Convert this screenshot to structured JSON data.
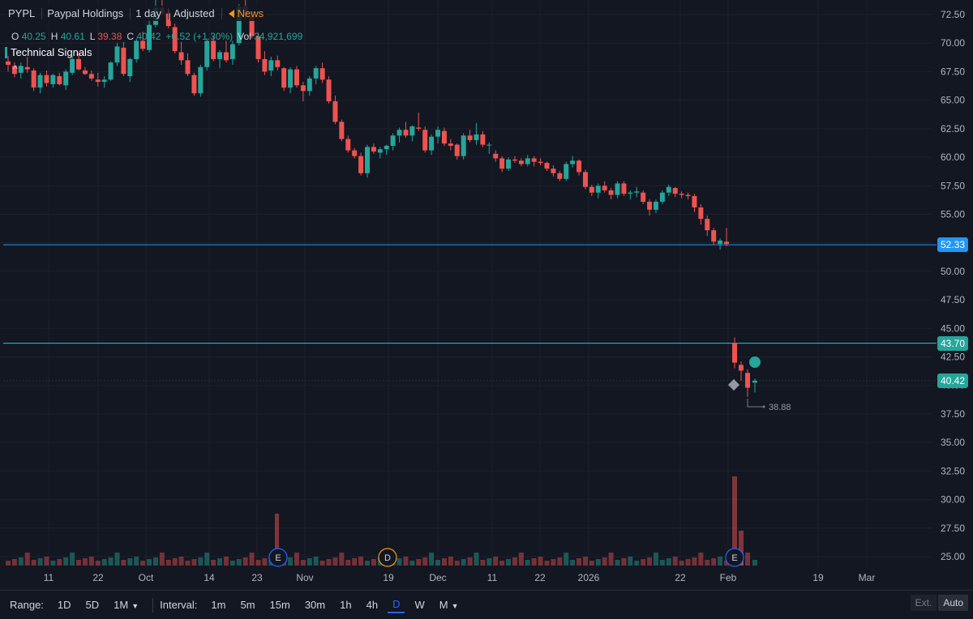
{
  "header": {
    "symbol": "PYPL",
    "name": "Paypal Holdings",
    "interval": "1 day",
    "adjusted": "Adjusted",
    "news": "News"
  },
  "ohlc": {
    "o_label": "O",
    "o": "40.25",
    "h_label": "H",
    "h": "40.61",
    "l_label": "L",
    "l": "39.38",
    "c_label": "C",
    "c": "40.42",
    "change": "+0.52 (+1.30%)",
    "vol_label": "Vol",
    "vol": "34,921,699"
  },
  "signals_label": "Technical Signals",
  "collapse_glyph": "^",
  "price_axis": [
    "72.50",
    "70.00",
    "67.50",
    "65.00",
    "62.50",
    "60.00",
    "57.50",
    "55.00",
    "52.50",
    "50.00",
    "47.50",
    "45.00",
    "42.50",
    "40.00",
    "37.50",
    "35.00",
    "32.50",
    "30.00",
    "27.50",
    "25.00"
  ],
  "price_tags": {
    "upper": "52.33",
    "mid": "43.70",
    "last": "40.42"
  },
  "low_marker": "38.88",
  "time_axis": [
    "11",
    "22",
    "Oct",
    "14",
    "23",
    "Nov",
    "19",
    "Dec",
    "11",
    "22",
    "2026",
    "22",
    "Feb",
    "19",
    "Mar"
  ],
  "events": [
    "E",
    "D",
    "E"
  ],
  "bottom": {
    "range_label": "Range:",
    "ranges": [
      "1D",
      "5D",
      "1M"
    ],
    "interval_label": "Interval:",
    "intervals": [
      "1m",
      "5m",
      "15m",
      "30m",
      "1h",
      "4h",
      "D",
      "W",
      "M"
    ],
    "active_interval": "D",
    "ext": "Ext.",
    "auto": "Auto"
  },
  "colors": {
    "up": "#26a69a",
    "down": "#ef5350",
    "bg": "#131722",
    "grid": "#1e222d",
    "line_blue": "#2196f3",
    "line_teal": "#26c6da",
    "tag_blue": "#2196f3",
    "tag_green": "#26a69a"
  },
  "chart_data": {
    "type": "candlestick",
    "ylim": [
      24.0,
      74.0
    ],
    "candles": [
      [
        68.4,
        68.9,
        67.5,
        68.1
      ],
      [
        68.0,
        68.3,
        67.0,
        67.3
      ],
      [
        67.4,
        68.3,
        66.9,
        68.0
      ],
      [
        67.9,
        68.8,
        67.4,
        67.7
      ],
      [
        67.6,
        67.8,
        65.8,
        66.1
      ],
      [
        66.1,
        67.4,
        65.6,
        67.2
      ],
      [
        67.2,
        67.6,
        66.2,
        66.5
      ],
      [
        66.4,
        67.3,
        66.1,
        67.2
      ],
      [
        67.1,
        67.4,
        66.3,
        66.4
      ],
      [
        66.3,
        67.7,
        65.9,
        67.5
      ],
      [
        67.4,
        68.9,
        67.2,
        68.6
      ],
      [
        68.6,
        69.2,
        67.6,
        67.7
      ],
      [
        67.6,
        67.9,
        67.2,
        67.3
      ],
      [
        67.3,
        67.6,
        66.7,
        66.9
      ],
      [
        66.8,
        67.4,
        66.2,
        66.6
      ],
      [
        66.6,
        67.1,
        66.1,
        66.8
      ],
      [
        66.8,
        68.4,
        66.7,
        68.3
      ],
      [
        68.3,
        70.0,
        68.0,
        69.7
      ],
      [
        69.6,
        70.1,
        67.1,
        67.3
      ],
      [
        67.1,
        68.7,
        66.6,
        68.6
      ],
      [
        68.6,
        70.4,
        68.3,
        70.2
      ],
      [
        70.2,
        71.0,
        69.3,
        69.5
      ],
      [
        69.4,
        72.4,
        69.2,
        71.6
      ],
      [
        71.6,
        73.8,
        71.4,
        73.1
      ],
      [
        73.1,
        74.0,
        72.4,
        72.6
      ],
      [
        72.6,
        72.9,
        71.3,
        71.5
      ],
      [
        71.4,
        71.7,
        69.1,
        69.3
      ],
      [
        69.2,
        70.1,
        68.1,
        68.5
      ],
      [
        68.5,
        69.1,
        67.1,
        67.3
      ],
      [
        67.2,
        67.4,
        65.4,
        65.6
      ],
      [
        65.6,
        68.1,
        65.3,
        67.9
      ],
      [
        67.9,
        70.4,
        67.6,
        70.2
      ],
      [
        70.2,
        70.6,
        68.4,
        68.6
      ],
      [
        68.6,
        69.4,
        67.8,
        69.2
      ],
      [
        69.2,
        70.2,
        68.3,
        68.5
      ],
      [
        68.6,
        70.2,
        68.1,
        69.9
      ],
      [
        70.0,
        73.4,
        69.8,
        73.2
      ],
      [
        73.2,
        74.0,
        72.0,
        72.4
      ],
      [
        72.4,
        72.8,
        70.4,
        70.6
      ],
      [
        70.6,
        70.9,
        68.3,
        68.6
      ],
      [
        68.6,
        69.3,
        67.2,
        67.5
      ],
      [
        67.6,
        68.8,
        67.1,
        68.5
      ],
      [
        68.5,
        68.9,
        67.6,
        67.9
      ],
      [
        67.8,
        67.9,
        65.8,
        66.1
      ],
      [
        66.1,
        67.9,
        65.6,
        67.7
      ],
      [
        67.7,
        68.0,
        66.1,
        66.3
      ],
      [
        66.3,
        66.6,
        64.9,
        65.8
      ],
      [
        65.8,
        67.1,
        65.4,
        66.9
      ],
      [
        66.9,
        68.0,
        66.4,
        67.8
      ],
      [
        67.8,
        68.3,
        66.5,
        66.8
      ],
      [
        66.8,
        67.1,
        64.7,
        64.9
      ],
      [
        64.9,
        65.4,
        62.9,
        63.1
      ],
      [
        63.1,
        63.3,
        61.4,
        61.6
      ],
      [
        61.6,
        61.9,
        60.4,
        60.6
      ],
      [
        60.6,
        60.8,
        59.9,
        60.1
      ],
      [
        60.1,
        60.4,
        58.4,
        58.6
      ],
      [
        58.6,
        61.1,
        58.2,
        60.9
      ],
      [
        60.9,
        61.2,
        60.3,
        60.5
      ],
      [
        60.4,
        60.9,
        59.9,
        60.7
      ],
      [
        60.7,
        61.1,
        60.2,
        61.0
      ],
      [
        61.0,
        62.1,
        60.6,
        61.9
      ],
      [
        61.9,
        62.6,
        61.3,
        62.4
      ],
      [
        62.4,
        63.1,
        61.7,
        61.9
      ],
      [
        61.9,
        62.8,
        61.4,
        62.7
      ],
      [
        62.6,
        63.9,
        62.3,
        62.5
      ],
      [
        62.4,
        62.7,
        60.4,
        60.6
      ],
      [
        60.6,
        62.0,
        60.2,
        61.8
      ],
      [
        61.8,
        62.7,
        61.2,
        62.4
      ],
      [
        62.3,
        62.6,
        61.0,
        61.2
      ],
      [
        61.2,
        61.6,
        60.6,
        61.0
      ],
      [
        61.1,
        61.2,
        59.8,
        60.1
      ],
      [
        60.1,
        62.1,
        59.8,
        61.9
      ],
      [
        61.9,
        62.4,
        61.3,
        61.5
      ],
      [
        61.5,
        63.0,
        61.1,
        62.0
      ],
      [
        62.0,
        62.3,
        60.9,
        61.1
      ],
      [
        61.1,
        61.3,
        60.3,
        61.1
      ],
      [
        60.3,
        60.6,
        59.6,
        59.9
      ],
      [
        59.9,
        60.1,
        58.7,
        59.0
      ],
      [
        59.0,
        60.0,
        58.8,
        59.8
      ],
      [
        59.8,
        60.1,
        59.5,
        59.7
      ],
      [
        59.7,
        59.9,
        59.2,
        59.4
      ],
      [
        59.4,
        60.2,
        59.2,
        59.9
      ],
      [
        59.9,
        60.1,
        59.2,
        59.6
      ],
      [
        59.6,
        59.9,
        59.3,
        59.5
      ],
      [
        59.5,
        59.6,
        58.8,
        59.0
      ],
      [
        59.0,
        59.3,
        58.3,
        58.6
      ],
      [
        58.6,
        58.8,
        57.9,
        58.1
      ],
      [
        58.1,
        59.6,
        57.9,
        59.4
      ],
      [
        59.4,
        60.1,
        59.1,
        59.7
      ],
      [
        59.7,
        59.8,
        58.4,
        58.7
      ],
      [
        58.7,
        58.9,
        57.2,
        57.4
      ],
      [
        57.4,
        57.6,
        56.6,
        56.9
      ],
      [
        56.9,
        57.7,
        56.4,
        57.5
      ],
      [
        57.5,
        57.9,
        56.9,
        57.1
      ],
      [
        57.1,
        57.3,
        56.3,
        56.7
      ],
      [
        56.7,
        57.9,
        56.4,
        57.7
      ],
      [
        57.7,
        57.9,
        56.6,
        56.8
      ],
      [
        56.8,
        57.1,
        56.3,
        56.9
      ],
      [
        56.9,
        57.4,
        56.5,
        57.0
      ],
      [
        56.9,
        57.1,
        55.9,
        56.1
      ],
      [
        56.1,
        56.3,
        54.9,
        55.4
      ],
      [
        55.4,
        56.3,
        55.1,
        56.1
      ],
      [
        56.1,
        57.1,
        55.9,
        56.9
      ],
      [
        56.9,
        57.6,
        56.6,
        57.4
      ],
      [
        57.3,
        57.4,
        56.5,
        56.8
      ],
      [
        56.8,
        57.0,
        56.4,
        56.7
      ],
      [
        56.7,
        56.9,
        56.3,
        56.6
      ],
      [
        56.6,
        56.8,
        55.2,
        55.6
      ],
      [
        55.6,
        55.9,
        54.1,
        54.6
      ],
      [
        54.6,
        54.9,
        53.1,
        53.6
      ],
      [
        53.6,
        53.8,
        52.3,
        52.6
      ],
      [
        52.4,
        52.9,
        51.9,
        52.7
      ],
      [
        52.6,
        53.8,
        52.2,
        52.4
      ],
      [
        43.7,
        44.2,
        41.5,
        42.0
      ],
      [
        41.8,
        42.1,
        40.4,
        41.3
      ],
      [
        41.1,
        41.4,
        39.0,
        39.8
      ],
      [
        40.25,
        40.61,
        39.38,
        40.42
      ]
    ],
    "volume_colors_note": "up/down",
    "event_markers": [
      {
        "label": "E",
        "date": "earnings"
      },
      {
        "label": "D",
        "date": "dividend"
      },
      {
        "label": "E",
        "date": "earnings"
      }
    ]
  }
}
